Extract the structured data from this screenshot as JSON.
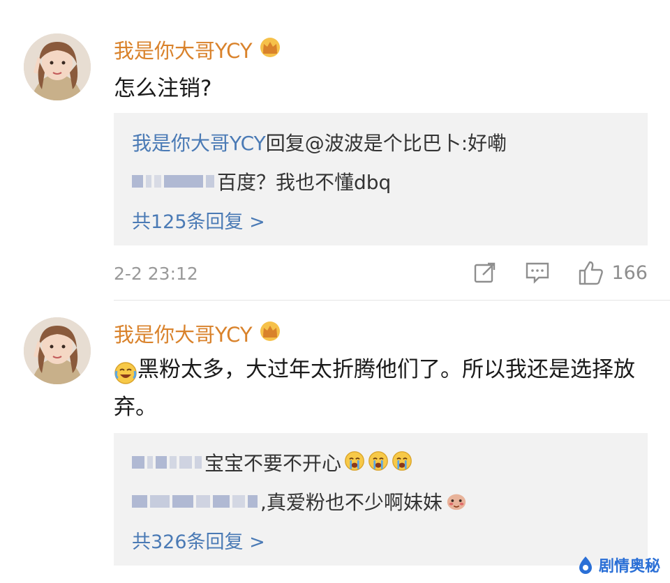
{
  "comments": [
    {
      "username": "我是你大哥YCY",
      "text": "怎么注销?",
      "replies": [
        {
          "name": "我是你大哥YCY",
          "text": "回复@波波是个比巴卜:好嘞"
        },
        {
          "name": "",
          "text": "百度？我也不懂dbq"
        }
      ],
      "more_replies": "共125条回复 >",
      "time": "2-2 23:12",
      "likes": "166"
    },
    {
      "username": "我是你大哥YCY",
      "text": "黑粉太多，大过年太折腾他们了。所以我还是选择放弃。",
      "replies": [
        {
          "name": "",
          "text": "宝宝不要不开心"
        },
        {
          "name": "",
          "text": ",真爱粉也不少啊妹妹"
        }
      ],
      "more_replies": "共326条回复 >"
    }
  ],
  "icons": {
    "crown": "crown-icon",
    "repost": "repost-icon",
    "comment": "comment-icon",
    "like": "like-icon",
    "emoji_cry_laugh": "laugh-cry-emoji",
    "emoji_cry": "cry-emoji",
    "emoji_shy": "shy-emoji"
  },
  "colors": {
    "username": "#d9822b",
    "reply_name": "#4a7ab5",
    "reply_bg": "#f2f2f2",
    "meta": "#999999"
  },
  "watermark": "剧情奥秘"
}
